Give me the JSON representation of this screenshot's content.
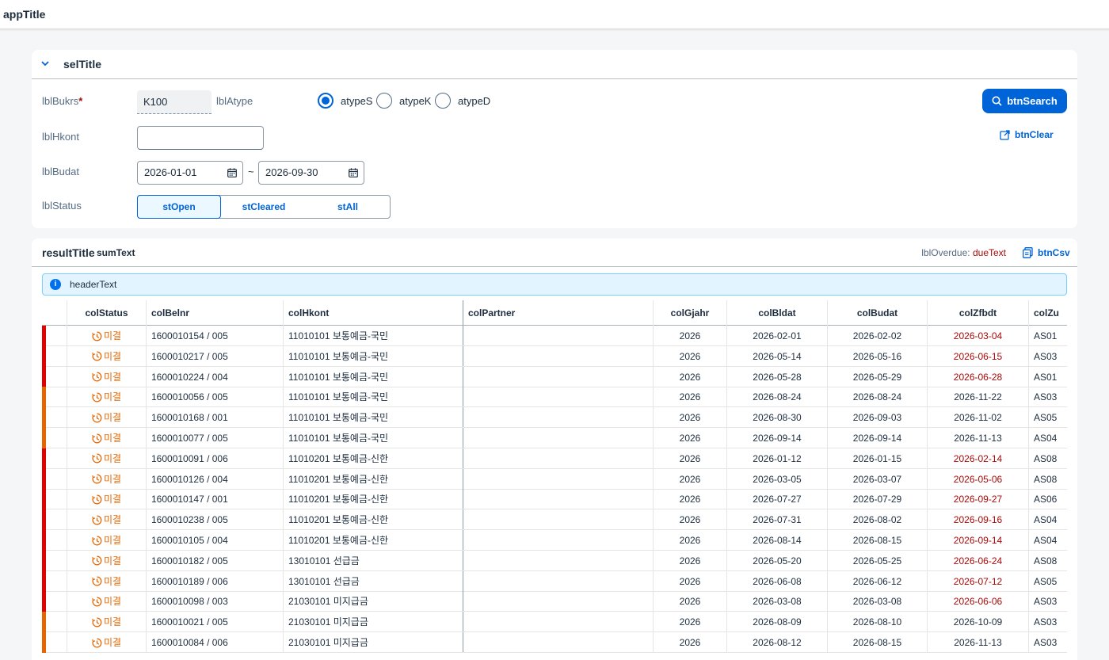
{
  "app": {
    "title": "appTitle"
  },
  "selection": {
    "title": "selTitle",
    "bukrs": {
      "label": "lblBukrs",
      "required": "*",
      "value": "K100"
    },
    "atype": {
      "label": "lblAtype",
      "options": [
        "atypeS",
        "atypeK",
        "atypeD"
      ],
      "selected": "atypeS"
    },
    "hkont": {
      "label": "lblHkont",
      "value": ""
    },
    "budat": {
      "label": "lblBudat",
      "from": "2026-01-01",
      "to": "2026-09-30",
      "sep": "~"
    },
    "status": {
      "label": "lblStatus",
      "options": [
        "stOpen",
        "stCleared",
        "stAll"
      ],
      "selected": "stOpen"
    },
    "search_label": "btnSearch",
    "clear_label": "btnClear"
  },
  "result": {
    "title": "resultTitle",
    "sum": "sumText",
    "overdue_label": "lblOverdue:",
    "overdue_value": "dueText",
    "csv_label": "btnCsv",
    "info": "headerText",
    "columns": [
      "colStatus",
      "colBelnr",
      "colHkont",
      "colPartner",
      "colGjahr",
      "colBldat",
      "colBudat",
      "colZfbdt",
      "colZu"
    ],
    "colors": {
      "red": "#e00000",
      "orange": "#e76500",
      "accent": "#0064d9"
    },
    "rows": [
      {
        "ind": "red",
        "status": "미결",
        "belnr": "1600010154 / 005",
        "hkont": "11010101 보통예금-국민",
        "partner": "",
        "gjahr": "2026",
        "bldat": "2026-02-01",
        "budat": "2026-02-02",
        "zfbdt": "2026-03-04",
        "overdue": true,
        "zu": "AS01"
      },
      {
        "ind": "red",
        "status": "미결",
        "belnr": "1600010217 / 005",
        "hkont": "11010101 보통예금-국민",
        "partner": "",
        "gjahr": "2026",
        "bldat": "2026-05-14",
        "budat": "2026-05-16",
        "zfbdt": "2026-06-15",
        "overdue": true,
        "zu": "AS03"
      },
      {
        "ind": "red",
        "status": "미결",
        "belnr": "1600010224 / 004",
        "hkont": "11010101 보통예금-국민",
        "partner": "",
        "gjahr": "2026",
        "bldat": "2026-05-28",
        "budat": "2026-05-29",
        "zfbdt": "2026-06-28",
        "overdue": true,
        "zu": "AS01"
      },
      {
        "ind": "orange",
        "status": "미결",
        "belnr": "1600010056 / 005",
        "hkont": "11010101 보통예금-국민",
        "partner": "",
        "gjahr": "2026",
        "bldat": "2026-08-24",
        "budat": "2026-08-24",
        "zfbdt": "2026-11-22",
        "overdue": false,
        "zu": "AS03"
      },
      {
        "ind": "orange",
        "status": "미결",
        "belnr": "1600010168 / 001",
        "hkont": "11010101 보통예금-국민",
        "partner": "",
        "gjahr": "2026",
        "bldat": "2026-08-30",
        "budat": "2026-09-03",
        "zfbdt": "2026-11-02",
        "overdue": false,
        "zu": "AS05"
      },
      {
        "ind": "orange",
        "status": "미결",
        "belnr": "1600010077 / 005",
        "hkont": "11010101 보통예금-국민",
        "partner": "",
        "gjahr": "2026",
        "bldat": "2026-09-14",
        "budat": "2026-09-14",
        "zfbdt": "2026-11-13",
        "overdue": false,
        "zu": "AS04"
      },
      {
        "ind": "red",
        "status": "미결",
        "belnr": "1600010091 / 006",
        "hkont": "11010201 보통예금-신한",
        "partner": "",
        "gjahr": "2026",
        "bldat": "2026-01-12",
        "budat": "2026-01-15",
        "zfbdt": "2026-02-14",
        "overdue": true,
        "zu": "AS08"
      },
      {
        "ind": "red",
        "status": "미결",
        "belnr": "1600010126 / 004",
        "hkont": "11010201 보통예금-신한",
        "partner": "",
        "gjahr": "2026",
        "bldat": "2026-03-05",
        "budat": "2026-03-07",
        "zfbdt": "2026-05-06",
        "overdue": true,
        "zu": "AS08"
      },
      {
        "ind": "red",
        "status": "미결",
        "belnr": "1600010147 / 001",
        "hkont": "11010201 보통예금-신한",
        "partner": "",
        "gjahr": "2026",
        "bldat": "2026-07-27",
        "budat": "2026-07-29",
        "zfbdt": "2026-09-27",
        "overdue": true,
        "zu": "AS06"
      },
      {
        "ind": "red",
        "status": "미결",
        "belnr": "1600010238 / 005",
        "hkont": "11010201 보통예금-신한",
        "partner": "",
        "gjahr": "2026",
        "bldat": "2026-07-31",
        "budat": "2026-08-02",
        "zfbdt": "2026-09-16",
        "overdue": true,
        "zu": "AS04"
      },
      {
        "ind": "red",
        "status": "미결",
        "belnr": "1600010105 / 004",
        "hkont": "11010201 보통예금-신한",
        "partner": "",
        "gjahr": "2026",
        "bldat": "2026-08-14",
        "budat": "2026-08-15",
        "zfbdt": "2026-09-14",
        "overdue": true,
        "zu": "AS04"
      },
      {
        "ind": "red",
        "status": "미결",
        "belnr": "1600010182 / 005",
        "hkont": "13010101 선급금",
        "partner": "",
        "gjahr": "2026",
        "bldat": "2026-05-20",
        "budat": "2026-05-25",
        "zfbdt": "2026-06-24",
        "overdue": true,
        "zu": "AS08"
      },
      {
        "ind": "red",
        "status": "미결",
        "belnr": "1600010189 / 006",
        "hkont": "13010101 선급금",
        "partner": "",
        "gjahr": "2026",
        "bldat": "2026-06-08",
        "budat": "2026-06-12",
        "zfbdt": "2026-07-12",
        "overdue": true,
        "zu": "AS05"
      },
      {
        "ind": "red",
        "status": "미결",
        "belnr": "1600010098 / 003",
        "hkont": "21030101 미지급금",
        "partner": "",
        "gjahr": "2026",
        "bldat": "2026-03-08",
        "budat": "2026-03-08",
        "zfbdt": "2026-06-06",
        "overdue": true,
        "zu": "AS03"
      },
      {
        "ind": "orange",
        "status": "미결",
        "belnr": "1600010021 / 005",
        "hkont": "21030101 미지급금",
        "partner": "",
        "gjahr": "2026",
        "bldat": "2026-08-09",
        "budat": "2026-08-10",
        "zfbdt": "2026-10-09",
        "overdue": false,
        "zu": "AS03"
      },
      {
        "ind": "orange",
        "status": "미결",
        "belnr": "1600010084 / 006",
        "hkont": "21030101 미지급금",
        "partner": "",
        "gjahr": "2026",
        "bldat": "2026-08-12",
        "budat": "2026-08-15",
        "zfbdt": "2026-11-13",
        "overdue": false,
        "zu": "AS03"
      }
    ]
  }
}
